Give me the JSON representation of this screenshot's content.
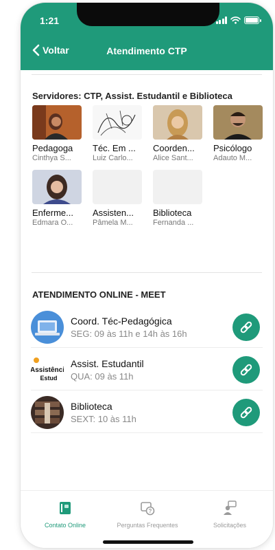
{
  "status": {
    "time": "1:21"
  },
  "header": {
    "back_label": "Voltar",
    "title": "Atendimento CTP"
  },
  "servers": {
    "title": "Servidores: CTP, Assist. Estudantil e Biblioteca",
    "items": [
      {
        "role": "Pedagoga",
        "name": "Cinthya S..."
      },
      {
        "role": "Téc. Em ...",
        "name": "Luiz Carlo..."
      },
      {
        "role": "Coorden...",
        "name": "Alice Sant..."
      },
      {
        "role": "Psicólogo",
        "name": "Adauto M..."
      },
      {
        "role": "Enferme...",
        "name": "Edmara O..."
      },
      {
        "role": "Assisten...",
        "name": "Pâmela M..."
      },
      {
        "role": "Biblioteca",
        "name": "Fernanda ..."
      }
    ]
  },
  "online": {
    "title": "ATENDIMENTO ONLINE - MEET",
    "items": [
      {
        "name": "Coord. Téc-Pedagógica",
        "time": "SEG: 09 às 11h e 14h às 16h"
      },
      {
        "name": "Assist. Estudantil",
        "time": "QUA: 09 às 11h",
        "logo_lines": [
          "Assistênci",
          "Estud"
        ]
      },
      {
        "name": "Biblioteca",
        "time": "SEXT: 10 às 11h"
      }
    ]
  },
  "tabs": [
    {
      "label": "Contato Online",
      "icon": "contact-book-icon",
      "active": true
    },
    {
      "label": "Perguntas Frequentes",
      "icon": "faq-question-icon",
      "active": false
    },
    {
      "label": "Solicitações",
      "icon": "requests-person-icon",
      "active": false
    }
  ],
  "colors": {
    "primary": "#1f9a7a",
    "text": "#111111",
    "muted": "#888888"
  }
}
